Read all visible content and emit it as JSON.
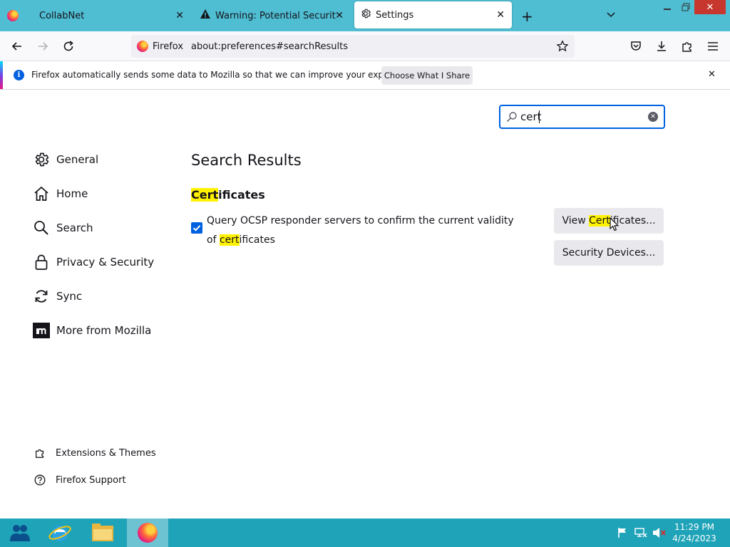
{
  "tabs": [
    {
      "title": "CollabNet",
      "icon": "firefox-icon",
      "active": false
    },
    {
      "title": "Warning: Potential Security Risk",
      "icon": "warning-icon",
      "active": false
    },
    {
      "title": "Settings",
      "icon": "gear-icon",
      "active": true
    }
  ],
  "urlbar": {
    "identity_label": "Firefox",
    "url": "about:preferences#searchResults"
  },
  "notification": {
    "message": "Firefox automatically sends some data to Mozilla so that we can improve your experience.",
    "button_label": "Choose What I Share"
  },
  "search": {
    "value": "cert"
  },
  "sidebar": {
    "items": [
      {
        "label": "General",
        "icon": "gear-icon"
      },
      {
        "label": "Home",
        "icon": "home-icon"
      },
      {
        "label": "Search",
        "icon": "search-icon"
      },
      {
        "label": "Privacy & Security",
        "icon": "lock-icon"
      },
      {
        "label": "Sync",
        "icon": "sync-icon"
      },
      {
        "label": "More from Mozilla",
        "icon": "mozilla-icon"
      }
    ],
    "footer": [
      {
        "label": "Extensions & Themes",
        "icon": "puzzle-icon"
      },
      {
        "label": "Firefox Support",
        "icon": "help-icon"
      }
    ]
  },
  "main": {
    "heading": "Search Results",
    "section": {
      "title_highlight": "Cert",
      "title_rest": "ificates"
    },
    "ocsp": {
      "text_1": "Query OCSP responder servers to confirm the current validity of",
      "highlight": "cert",
      "text_2": "ificates",
      "checked": true
    },
    "view_button": {
      "prefix": "View ",
      "highlight": "Cert",
      "suffix": "ificates..."
    },
    "devices_button": {
      "label": "Security Devices..."
    }
  },
  "taskbar": {
    "time": "11:29 PM",
    "date": "4/24/2023"
  },
  "colors": {
    "accent": "#0061e0",
    "highlight": "#fff200",
    "tabstrip": "#4fbdd2",
    "taskbar": "#1fa3b8"
  }
}
